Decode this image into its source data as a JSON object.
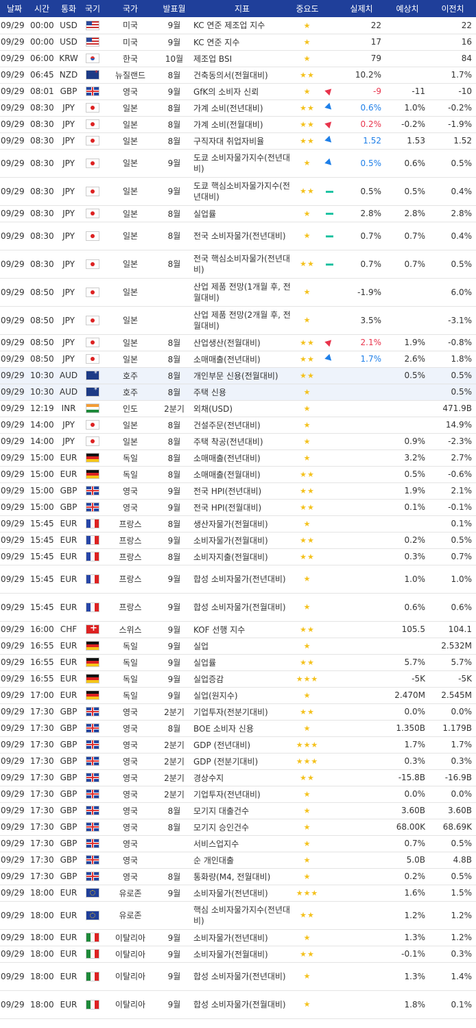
{
  "headers": [
    "날짜",
    "시간",
    "통화",
    "국기",
    "국가",
    "발표월",
    "지표",
    "중요도",
    "",
    "실제치",
    "예상치",
    "이전치"
  ],
  "rows": [
    {
      "date": "09/29",
      "time": "00:00",
      "cur": "USD",
      "flag": "us",
      "country": "미국",
      "period": "9월",
      "indicator": "KC 연준 제조업 지수",
      "imp": 1,
      "trend": "",
      "actual": "22",
      "actual_color": "",
      "forecast": "",
      "previous": "22",
      "h": 24
    },
    {
      "date": "09/29",
      "time": "00:00",
      "cur": "USD",
      "flag": "us",
      "country": "미국",
      "period": "9월",
      "indicator": "KC 연준 지수",
      "imp": 1,
      "trend": "",
      "actual": "17",
      "actual_color": "",
      "forecast": "",
      "previous": "16",
      "h": 24
    },
    {
      "date": "09/29",
      "time": "06:00",
      "cur": "KRW",
      "flag": "kr",
      "country": "한국",
      "period": "10월",
      "indicator": "제조업 BSI",
      "imp": 1,
      "trend": "",
      "actual": "79",
      "actual_color": "",
      "forecast": "",
      "previous": "84",
      "h": 24
    },
    {
      "date": "09/29",
      "time": "06:45",
      "cur": "NZD",
      "flag": "nz",
      "country": "뉴질랜드",
      "period": "8월",
      "indicator": "건축동의서(전월대비)",
      "imp": 2,
      "trend": "",
      "actual": "10.2%",
      "actual_color": "",
      "forecast": "",
      "previous": "1.7%",
      "h": 24
    },
    {
      "date": "09/29",
      "time": "08:01",
      "cur": "GBP",
      "flag": "gb",
      "country": "영국",
      "period": "9월",
      "indicator": "GfK의 소비자 신뢰",
      "imp": 1,
      "trend": "up",
      "actual": "-9",
      "actual_color": "up",
      "forecast": "-11",
      "previous": "-10",
      "h": 24
    },
    {
      "date": "09/29",
      "time": "08:30",
      "cur": "JPY",
      "flag": "jp",
      "country": "일본",
      "period": "8월",
      "indicator": "가계 소비(전년대비)",
      "imp": 2,
      "trend": "dn",
      "actual": "0.6%",
      "actual_color": "dn",
      "forecast": "1.0%",
      "previous": "-0.2%",
      "h": 24
    },
    {
      "date": "09/29",
      "time": "08:30",
      "cur": "JPY",
      "flag": "jp",
      "country": "일본",
      "period": "8월",
      "indicator": "가계 소비(전월대비)",
      "imp": 2,
      "trend": "up",
      "actual": "0.2%",
      "actual_color": "up",
      "forecast": "-0.2%",
      "previous": "-1.9%",
      "h": 24
    },
    {
      "date": "09/29",
      "time": "08:30",
      "cur": "JPY",
      "flag": "jp",
      "country": "일본",
      "period": "8월",
      "indicator": "구직자대 취업자비율",
      "imp": 2,
      "trend": "dn",
      "actual": "1.52",
      "actual_color": "dn",
      "forecast": "1.53",
      "previous": "1.52",
      "h": 24
    },
    {
      "date": "09/29",
      "time": "08:30",
      "cur": "JPY",
      "flag": "jp",
      "country": "일본",
      "period": "9월",
      "indicator": "도쿄 소비자물가지수(전년대비)",
      "imp": 1,
      "trend": "dn",
      "actual": "0.5%",
      "actual_color": "dn",
      "forecast": "0.6%",
      "previous": "0.5%",
      "h": 41
    },
    {
      "date": "09/29",
      "time": "08:30",
      "cur": "JPY",
      "flag": "jp",
      "country": "일본",
      "period": "9월",
      "indicator": "도쿄 핵심소비자물가지수(전년대비)",
      "imp": 2,
      "trend": "eq",
      "actual": "0.5%",
      "actual_color": "",
      "forecast": "0.5%",
      "previous": "0.4%",
      "h": 41
    },
    {
      "date": "09/29",
      "time": "08:30",
      "cur": "JPY",
      "flag": "jp",
      "country": "일본",
      "period": "8월",
      "indicator": "실업률",
      "imp": 1,
      "trend": "eq",
      "actual": "2.8%",
      "actual_color": "",
      "forecast": "2.8%",
      "previous": "2.8%",
      "h": 24
    },
    {
      "date": "09/29",
      "time": "08:30",
      "cur": "JPY",
      "flag": "jp",
      "country": "일본",
      "period": "8월",
      "indicator": "전국 소비자물가(전년대비)",
      "imp": 1,
      "trend": "eq",
      "actual": "0.7%",
      "actual_color": "",
      "forecast": "0.7%",
      "previous": "0.4%",
      "h": 41
    },
    {
      "date": "09/29",
      "time": "08:30",
      "cur": "JPY",
      "flag": "jp",
      "country": "일본",
      "period": "8월",
      "indicator": "전국 핵심소비자물가(전년대비)",
      "imp": 2,
      "trend": "eq",
      "actual": "0.7%",
      "actual_color": "",
      "forecast": "0.7%",
      "previous": "0.5%",
      "h": 41
    },
    {
      "date": "09/29",
      "time": "08:50",
      "cur": "JPY",
      "flag": "jp",
      "country": "일본",
      "period": "",
      "indicator": "산업 제품 전망(1개월 후, 전월대비)",
      "imp": 1,
      "trend": "",
      "actual": "-1.9%",
      "actual_color": "",
      "forecast": "",
      "previous": "6.0%",
      "h": 41
    },
    {
      "date": "09/29",
      "time": "08:50",
      "cur": "JPY",
      "flag": "jp",
      "country": "일본",
      "period": "",
      "indicator": "산업 제품 전망(2개월 후, 전월대비)",
      "imp": 1,
      "trend": "",
      "actual": "3.5%",
      "actual_color": "",
      "forecast": "",
      "previous": "-3.1%",
      "h": 41
    },
    {
      "date": "09/29",
      "time": "08:50",
      "cur": "JPY",
      "flag": "jp",
      "country": "일본",
      "period": "8월",
      "indicator": "산업생산(전월대비)",
      "imp": 2,
      "trend": "up",
      "actual": "2.1%",
      "actual_color": "up",
      "forecast": "1.9%",
      "previous": "-0.8%",
      "h": 24
    },
    {
      "date": "09/29",
      "time": "08:50",
      "cur": "JPY",
      "flag": "jp",
      "country": "일본",
      "period": "8월",
      "indicator": "소매매출(전년대비)",
      "imp": 2,
      "trend": "dn",
      "actual": "1.7%",
      "actual_color": "dn",
      "forecast": "2.6%",
      "previous": "1.8%",
      "h": 24
    },
    {
      "date": "09/29",
      "time": "10:30",
      "cur": "AUD",
      "flag": "au",
      "country": "호주",
      "period": "8월",
      "indicator": "개인부문 신용(전월대비)",
      "imp": 2,
      "trend": "",
      "actual": "",
      "actual_color": "",
      "forecast": "0.5%",
      "previous": "0.5%",
      "h": 24,
      "hl": true
    },
    {
      "date": "09/29",
      "time": "10:30",
      "cur": "AUD",
      "flag": "au",
      "country": "호주",
      "period": "8월",
      "indicator": "주택 신용",
      "imp": 1,
      "trend": "",
      "actual": "",
      "actual_color": "",
      "forecast": "",
      "previous": "0.5%",
      "h": 24,
      "hl": true
    },
    {
      "date": "09/29",
      "time": "12:19",
      "cur": "INR",
      "flag": "in",
      "country": "인도",
      "period": "2분기",
      "indicator": "외채(USD)",
      "imp": 1,
      "trend": "",
      "actual": "",
      "actual_color": "",
      "forecast": "",
      "previous": "471.9B",
      "h": 24
    },
    {
      "date": "09/29",
      "time": "14:00",
      "cur": "JPY",
      "flag": "jp",
      "country": "일본",
      "period": "8월",
      "indicator": "건설주문(전년대비)",
      "imp": 1,
      "trend": "",
      "actual": "",
      "actual_color": "",
      "forecast": "",
      "previous": "14.9%",
      "h": 24
    },
    {
      "date": "09/29",
      "time": "14:00",
      "cur": "JPY",
      "flag": "jp",
      "country": "일본",
      "period": "8월",
      "indicator": "주택 착공(전년대비)",
      "imp": 1,
      "trend": "",
      "actual": "",
      "actual_color": "",
      "forecast": "0.9%",
      "previous": "-2.3%",
      "h": 24
    },
    {
      "date": "09/29",
      "time": "15:00",
      "cur": "EUR",
      "flag": "de",
      "country": "독일",
      "period": "8월",
      "indicator": "소매매출(전년대비)",
      "imp": 1,
      "trend": "",
      "actual": "",
      "actual_color": "",
      "forecast": "3.2%",
      "previous": "2.7%",
      "h": 24
    },
    {
      "date": "09/29",
      "time": "15:00",
      "cur": "EUR",
      "flag": "de",
      "country": "독일",
      "period": "8월",
      "indicator": "소매매출(전월대비)",
      "imp": 2,
      "trend": "",
      "actual": "",
      "actual_color": "",
      "forecast": "0.5%",
      "previous": "-0.6%",
      "h": 24
    },
    {
      "date": "09/29",
      "time": "15:00",
      "cur": "GBP",
      "flag": "gb",
      "country": "영국",
      "period": "9월",
      "indicator": "전국 HPI(전년대비)",
      "imp": 2,
      "trend": "",
      "actual": "",
      "actual_color": "",
      "forecast": "1.9%",
      "previous": "2.1%",
      "h": 24
    },
    {
      "date": "09/29",
      "time": "15:00",
      "cur": "GBP",
      "flag": "gb",
      "country": "영국",
      "period": "9월",
      "indicator": "전국 HPI(전월대비)",
      "imp": 2,
      "trend": "",
      "actual": "",
      "actual_color": "",
      "forecast": "0.1%",
      "previous": "-0.1%",
      "h": 24
    },
    {
      "date": "09/29",
      "time": "15:45",
      "cur": "EUR",
      "flag": "fr",
      "country": "프랑스",
      "period": "8월",
      "indicator": "생산자물가(전월대비)",
      "imp": 1,
      "trend": "",
      "actual": "",
      "actual_color": "",
      "forecast": "",
      "previous": "0.1%",
      "h": 24
    },
    {
      "date": "09/29",
      "time": "15:45",
      "cur": "EUR",
      "flag": "fr",
      "country": "프랑스",
      "period": "9월",
      "indicator": "소비자물가(전월대비)",
      "imp": 2,
      "trend": "",
      "actual": "",
      "actual_color": "",
      "forecast": "0.2%",
      "previous": "0.5%",
      "h": 24
    },
    {
      "date": "09/29",
      "time": "15:45",
      "cur": "EUR",
      "flag": "fr",
      "country": "프랑스",
      "period": "8월",
      "indicator": "소비자지출(전월대비)",
      "imp": 2,
      "trend": "",
      "actual": "",
      "actual_color": "",
      "forecast": "0.3%",
      "previous": "0.7%",
      "h": 24
    },
    {
      "date": "09/29",
      "time": "15:45",
      "cur": "EUR",
      "flag": "fr",
      "country": "프랑스",
      "period": "9월",
      "indicator": "합성 소비자물가(전년대비)",
      "imp": 1,
      "trend": "",
      "actual": "",
      "actual_color": "",
      "forecast": "1.0%",
      "previous": "1.0%",
      "h": 41
    },
    {
      "date": "09/29",
      "time": "15:45",
      "cur": "EUR",
      "flag": "fr",
      "country": "프랑스",
      "period": "9월",
      "indicator": "합성 소비자물가(전월대비)",
      "imp": 1,
      "trend": "",
      "actual": "",
      "actual_color": "",
      "forecast": "0.6%",
      "previous": "0.6%",
      "h": 41
    },
    {
      "date": "09/29",
      "time": "16:00",
      "cur": "CHF",
      "flag": "ch",
      "country": "스위스",
      "period": "9월",
      "indicator": "KOF 선행 지수",
      "imp": 2,
      "trend": "",
      "actual": "",
      "actual_color": "",
      "forecast": "105.5",
      "previous": "104.1",
      "h": 24
    },
    {
      "date": "09/29",
      "time": "16:55",
      "cur": "EUR",
      "flag": "de",
      "country": "독일",
      "period": "9월",
      "indicator": "실업",
      "imp": 1,
      "trend": "",
      "actual": "",
      "actual_color": "",
      "forecast": "",
      "previous": "2.532M",
      "h": 24
    },
    {
      "date": "09/29",
      "time": "16:55",
      "cur": "EUR",
      "flag": "de",
      "country": "독일",
      "period": "9월",
      "indicator": "실업률",
      "imp": 2,
      "trend": "",
      "actual": "",
      "actual_color": "",
      "forecast": "5.7%",
      "previous": "5.7%",
      "h": 24
    },
    {
      "date": "09/29",
      "time": "16:55",
      "cur": "EUR",
      "flag": "de",
      "country": "독일",
      "period": "9월",
      "indicator": "실업증감",
      "imp": 3,
      "trend": "",
      "actual": "",
      "actual_color": "",
      "forecast": "-5K",
      "previous": "-5K",
      "h": 24
    },
    {
      "date": "09/29",
      "time": "17:00",
      "cur": "EUR",
      "flag": "de",
      "country": "독일",
      "period": "9월",
      "indicator": "실업(원지수)",
      "imp": 1,
      "trend": "",
      "actual": "",
      "actual_color": "",
      "forecast": "2.470M",
      "previous": "2.545M",
      "h": 24
    },
    {
      "date": "09/29",
      "time": "17:30",
      "cur": "GBP",
      "flag": "gb",
      "country": "영국",
      "period": "2분기",
      "indicator": "기업투자(전분기대비)",
      "imp": 2,
      "trend": "",
      "actual": "",
      "actual_color": "",
      "forecast": "0.0%",
      "previous": "0.0%",
      "h": 24
    },
    {
      "date": "09/29",
      "time": "17:30",
      "cur": "GBP",
      "flag": "gb",
      "country": "영국",
      "period": "8월",
      "indicator": "BOE 소비자 신용",
      "imp": 1,
      "trend": "",
      "actual": "",
      "actual_color": "",
      "forecast": "1.350B",
      "previous": "1.179B",
      "h": 24
    },
    {
      "date": "09/29",
      "time": "17:30",
      "cur": "GBP",
      "flag": "gb",
      "country": "영국",
      "period": "2분기",
      "indicator": "GDP (전년대비)",
      "imp": 3,
      "trend": "",
      "actual": "",
      "actual_color": "",
      "forecast": "1.7%",
      "previous": "1.7%",
      "h": 24
    },
    {
      "date": "09/29",
      "time": "17:30",
      "cur": "GBP",
      "flag": "gb",
      "country": "영국",
      "period": "2분기",
      "indicator": "GDP (전분기대비)",
      "imp": 3,
      "trend": "",
      "actual": "",
      "actual_color": "",
      "forecast": "0.3%",
      "previous": "0.3%",
      "h": 24
    },
    {
      "date": "09/29",
      "time": "17:30",
      "cur": "GBP",
      "flag": "gb",
      "country": "영국",
      "period": "2분기",
      "indicator": "경상수지",
      "imp": 2,
      "trend": "",
      "actual": "",
      "actual_color": "",
      "forecast": "-15.8B",
      "previous": "-16.9B",
      "h": 24
    },
    {
      "date": "09/29",
      "time": "17:30",
      "cur": "GBP",
      "flag": "gb",
      "country": "영국",
      "period": "2분기",
      "indicator": "기업투자(전년대비)",
      "imp": 1,
      "trend": "",
      "actual": "",
      "actual_color": "",
      "forecast": "0.0%",
      "previous": "0.0%",
      "h": 24
    },
    {
      "date": "09/29",
      "time": "17:30",
      "cur": "GBP",
      "flag": "gb",
      "country": "영국",
      "period": "8월",
      "indicator": "모기지 대출건수",
      "imp": 1,
      "trend": "",
      "actual": "",
      "actual_color": "",
      "forecast": "3.60B",
      "previous": "3.60B",
      "h": 24
    },
    {
      "date": "09/29",
      "time": "17:30",
      "cur": "GBP",
      "flag": "gb",
      "country": "영국",
      "period": "8월",
      "indicator": "모기지 승인건수",
      "imp": 1,
      "trend": "",
      "actual": "",
      "actual_color": "",
      "forecast": "68.00K",
      "previous": "68.69K",
      "h": 24
    },
    {
      "date": "09/29",
      "time": "17:30",
      "cur": "GBP",
      "flag": "gb",
      "country": "영국",
      "period": "",
      "indicator": "서비스업지수",
      "imp": 1,
      "trend": "",
      "actual": "",
      "actual_color": "",
      "forecast": "0.7%",
      "previous": "0.5%",
      "h": 24
    },
    {
      "date": "09/29",
      "time": "17:30",
      "cur": "GBP",
      "flag": "gb",
      "country": "영국",
      "period": "",
      "indicator": "순 개인대출",
      "imp": 1,
      "trend": "",
      "actual": "",
      "actual_color": "",
      "forecast": "5.0B",
      "previous": "4.8B",
      "h": 24
    },
    {
      "date": "09/29",
      "time": "17:30",
      "cur": "GBP",
      "flag": "gb",
      "country": "영국",
      "period": "8월",
      "indicator": "통화량(M4, 전월대비)",
      "imp": 1,
      "trend": "",
      "actual": "",
      "actual_color": "",
      "forecast": "0.2%",
      "previous": "0.5%",
      "h": 24
    },
    {
      "date": "09/29",
      "time": "18:00",
      "cur": "EUR",
      "flag": "eu",
      "country": "유로존",
      "period": "9월",
      "indicator": "소비자물가(전년대비)",
      "imp": 3,
      "trend": "",
      "actual": "",
      "actual_color": "",
      "forecast": "1.6%",
      "previous": "1.5%",
      "h": 24
    },
    {
      "date": "09/29",
      "time": "18:00",
      "cur": "EUR",
      "flag": "eu",
      "country": "유로존",
      "period": "",
      "indicator": "핵심 소비자물가지수(전년대비)",
      "imp": 2,
      "trend": "",
      "actual": "",
      "actual_color": "",
      "forecast": "1.2%",
      "previous": "1.2%",
      "h": 41
    },
    {
      "date": "09/29",
      "time": "18:00",
      "cur": "EUR",
      "flag": "it",
      "country": "이탈리아",
      "period": "9월",
      "indicator": "소비자물가(전년대비)",
      "imp": 1,
      "trend": "",
      "actual": "",
      "actual_color": "",
      "forecast": "1.3%",
      "previous": "1.2%",
      "h": 24
    },
    {
      "date": "09/29",
      "time": "18:00",
      "cur": "EUR",
      "flag": "it",
      "country": "이탈리아",
      "period": "9월",
      "indicator": "소비자물가(전월대비)",
      "imp": 2,
      "trend": "",
      "actual": "",
      "actual_color": "",
      "forecast": "-0.1%",
      "previous": "0.3%",
      "h": 24
    },
    {
      "date": "09/29",
      "time": "18:00",
      "cur": "EUR",
      "flag": "it",
      "country": "이탈리아",
      "period": "9월",
      "indicator": "합성 소비자물가(전년대비)",
      "imp": 1,
      "trend": "",
      "actual": "",
      "actual_color": "",
      "forecast": "1.3%",
      "previous": "1.4%",
      "h": 41
    },
    {
      "date": "09/29",
      "time": "18:00",
      "cur": "EUR",
      "flag": "it",
      "country": "이탈리아",
      "period": "9월",
      "indicator": "합성 소비자물가(전월대비)",
      "imp": 1,
      "trend": "",
      "actual": "",
      "actual_color": "",
      "forecast": "1.8%",
      "previous": "0.1%",
      "h": 41
    }
  ]
}
